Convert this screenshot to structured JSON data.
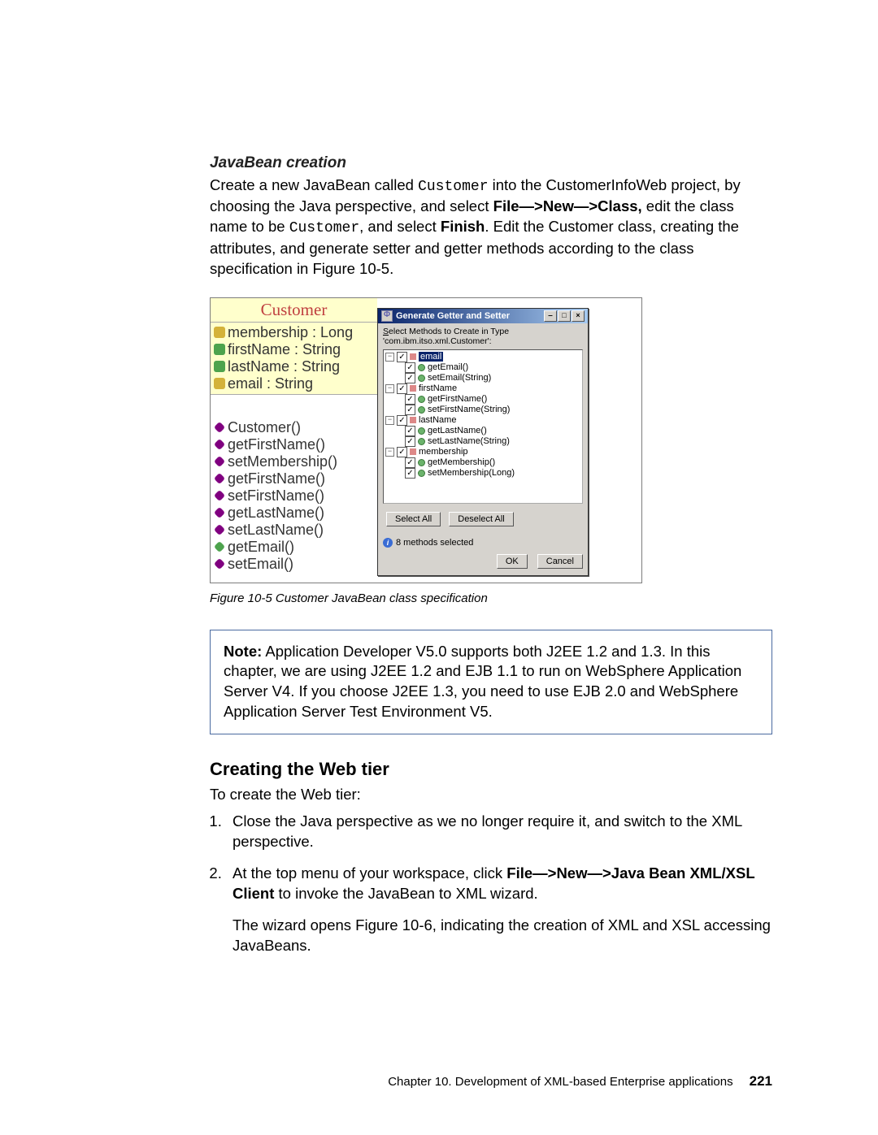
{
  "section": {
    "title": "JavaBean creation",
    "para_parts": {
      "p1a": "Create a new JavaBean called ",
      "mono1": "Customer",
      "p1b": " into the CustomerInfoWeb project, by choosing the Java perspective, and select ",
      "bold1": "File—>New—>Class,",
      "p1c": " edit the class name to be ",
      "mono2": "Customer",
      "p1d": ", and select ",
      "bold2": "Finish",
      "p1e": ". Edit the Customer class, creating the attributes, and generate setter and getter methods according to the class specification in Figure 10-5."
    }
  },
  "uml": {
    "class_name": "Customer",
    "attrs": [
      {
        "name": "membership : Long",
        "iconClass": "icn-field"
      },
      {
        "name": "firstName : String",
        "iconClass": "icn-field green"
      },
      {
        "name": "lastName : String",
        "iconClass": "icn-field green"
      },
      {
        "name": "email : String",
        "iconClass": "icn-field"
      }
    ],
    "ops": [
      {
        "name": "Customer()",
        "iconClass": "icn-method"
      },
      {
        "name": "getFirstName()",
        "iconClass": "icn-method"
      },
      {
        "name": "setMembership()",
        "iconClass": "icn-method"
      },
      {
        "name": "getFirstName()",
        "iconClass": "icn-method"
      },
      {
        "name": "setFirstName()",
        "iconClass": "icn-method"
      },
      {
        "name": "getLastName()",
        "iconClass": "icn-method"
      },
      {
        "name": "setLastName()",
        "iconClass": "icn-method"
      },
      {
        "name": "getEmail()",
        "iconClass": "icn-method green"
      },
      {
        "name": "setEmail()",
        "iconClass": "icn-method"
      }
    ]
  },
  "dialog": {
    "title": "Generate Getter and Setter",
    "prompt_pre": "S",
    "prompt_rest": "elect Methods to Create in Type 'com.ibm.itso.xml.Customer':",
    "groups": [
      {
        "name": "email",
        "selected": true,
        "children": [
          "getEmail()",
          "setEmail(String)"
        ]
      },
      {
        "name": "firstName",
        "selected": false,
        "children": [
          "getFirstName()",
          "setFirstName(String)"
        ]
      },
      {
        "name": "lastName",
        "selected": false,
        "children": [
          "getLastName()",
          "setLastName(String)"
        ]
      },
      {
        "name": "membership",
        "selected": false,
        "children": [
          "getMembership()",
          "setMembership(Long)"
        ]
      }
    ],
    "select_all": "Select All",
    "deselect_all": "Deselect All",
    "status": "8 methods selected",
    "ok": "OK",
    "cancel": "Cancel"
  },
  "caption": "Figure 10-5   Customer JavaBean class specification",
  "note": {
    "label": "Note:",
    "text": " Application Developer V5.0 supports both J2EE 1.2 and 1.3. In this chapter, we are using J2EE 1.2 and EJB 1.1 to run on WebSphere Application Server V4. If you choose J2EE 1.3, you need to use EJB 2.0 and WebSphere Application Server Test Environment V5."
  },
  "section2": {
    "title": "Creating the Web tier",
    "intro": "To create the Web tier:",
    "steps": {
      "s1": "Close the Java perspective as we no longer require it, and switch to the XML perspective.",
      "s2a": "At the top menu of your workspace, click ",
      "s2bold": "File—>New—>Java Bean XML/XSL Client",
      "s2b": " to invoke the JavaBean to XML wizard.",
      "s2c": "The wizard opens Figure 10-6, indicating the creation of XML and XSL accessing JavaBeans."
    }
  },
  "footer": {
    "chapter": "Chapter 10. Development of XML-based Enterprise applications",
    "page": "221"
  }
}
